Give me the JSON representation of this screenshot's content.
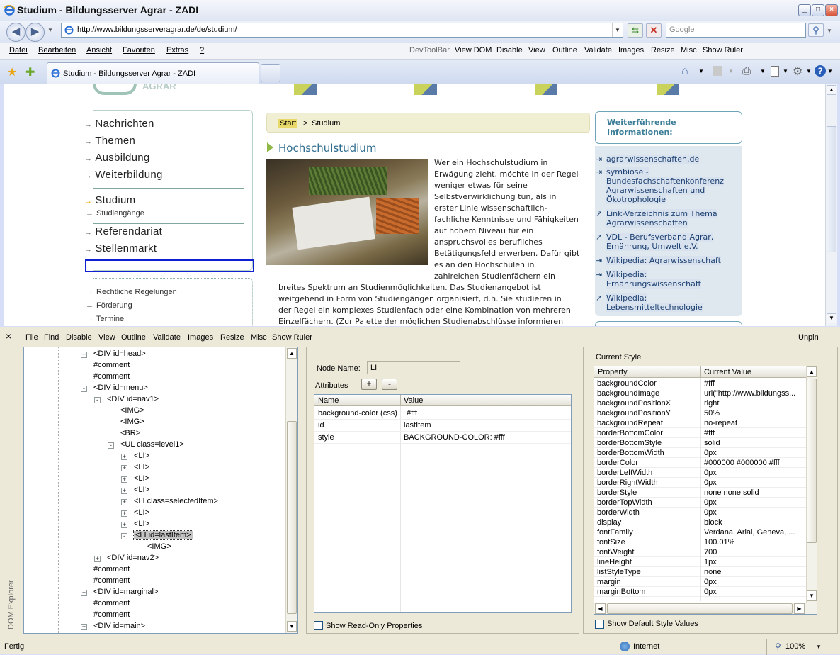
{
  "window": {
    "title": "Studium - Bildungsserver Agrar - ZADI"
  },
  "address": {
    "url": "http://www.bildungsserveragrar.de/de/studium/",
    "search_placeholder": "Google"
  },
  "menu": {
    "items": [
      "Datei",
      "Bearbeiten",
      "Ansicht",
      "Favoriten",
      "Extras",
      "?"
    ]
  },
  "devtoolbar": {
    "items": [
      "DevToolBar",
      "View DOM",
      "Disable",
      "View",
      "Outline",
      "Validate",
      "Images",
      "Resize",
      "Misc",
      "Show Ruler"
    ]
  },
  "tab": {
    "label": "Studium - Bildungsserver Agrar - ZADI"
  },
  "page": {
    "logo_text": "AGRAR",
    "nav1": [
      "Nachrichten",
      "Themen",
      "Ausbildung",
      "Weiterbildung"
    ],
    "selected": "Studium",
    "sub": "Studiengänge",
    "nav1b": [
      "Referendariat",
      "Stellenmarkt"
    ],
    "marginal": [
      "Rechtliche Regelungen",
      "Förderung",
      "Termine"
    ],
    "breadcrumb_start": "Start",
    "breadcrumb_sep": ">",
    "breadcrumb_current": "Studium",
    "heading": "Hochschulstudium",
    "para_lines_right": [
      "Wer ein Hochschulstudium in",
      "Erwägung zieht, möchte in der Regel",
      "weniger etwas für seine",
      "Selbstverwirklichung tun, als in",
      "erster Linie wissenschaftlich-",
      "fachliche Kenntnisse und Fähigkeiten",
      "auf hohem Niveau für ein",
      "anspruchsvolles berufliches",
      "Betätigungsfeld erwerben. Dafür gibt",
      "es an den Hochschulen in",
      "zahlreichen Studienfächern ein"
    ],
    "para_lines_full": [
      "breites Spektrum an Studienmöglichkeiten. Das Studienangebot ist",
      "weitgehend in Form von Studiengängen organisiert, d.h. Sie studieren in",
      "der Regel ein komplexes Studienfach oder eine Kombination von mehreren",
      "Einzelfächern. (Zur Palette der möglichen Studienabschlüsse informieren"
    ],
    "side_title_1": "Weiterführende",
    "side_title_2": "Informationen:",
    "links": [
      [
        "agrarwissenschaften.de"
      ],
      [
        "symbiose -",
        "Bundesfachschaftenkonferenz",
        "Agrarwissenschaften und",
        "Ökotrophologie"
      ],
      [
        "Link-Verzeichnis zum Thema",
        "Agrarwissenschaften"
      ],
      [
        "VDL - Berufsverband Agrar,",
        "Ernährung, Umwelt e.V."
      ],
      [
        "Wikipedia: Agrarwissenschaft"
      ],
      [
        "Wikipedia:",
        "Ernährungswissenschaft"
      ],
      [
        "Wikipedia:",
        "Lebensmitteltechnologie"
      ]
    ]
  },
  "dom": {
    "close": "×",
    "menu": [
      "File",
      "Find",
      "Disable",
      "View",
      "Outline",
      "Validate",
      "Images",
      "Resize",
      "Misc",
      "Show Ruler"
    ],
    "unpin": "Unpin",
    "sidebar_label": "DOM Explorer",
    "tree": [
      {
        "t": "<DIV id=head>",
        "x": 0,
        "e": "+"
      },
      {
        "t": "#comment",
        "x": 0,
        "e": ""
      },
      {
        "t": "#comment",
        "x": 0,
        "e": ""
      },
      {
        "t": "<DIV id=menu>",
        "x": 0,
        "e": "-"
      },
      {
        "t": "<DIV id=nav1>",
        "x": 1,
        "e": "-"
      },
      {
        "t": "<IMG>",
        "x": 2,
        "e": ""
      },
      {
        "t": "<IMG>",
        "x": 2,
        "e": ""
      },
      {
        "t": "<BR>",
        "x": 2,
        "e": ""
      },
      {
        "t": "<UL class=level1>",
        "x": 2,
        "e": "-"
      },
      {
        "t": "<LI>",
        "x": 3,
        "e": "+"
      },
      {
        "t": "<LI>",
        "x": 3,
        "e": "+"
      },
      {
        "t": "<LI>",
        "x": 3,
        "e": "+"
      },
      {
        "t": "<LI>",
        "x": 3,
        "e": "+"
      },
      {
        "t": "<LI class=selectedItem>",
        "x": 3,
        "e": "+"
      },
      {
        "t": "<LI>",
        "x": 3,
        "e": "+"
      },
      {
        "t": "<LI>",
        "x": 3,
        "e": "+"
      },
      {
        "t": "<LI id=lastItem>",
        "x": 3,
        "e": "-",
        "sel": true
      },
      {
        "t": "<IMG>",
        "x": 4,
        "e": ""
      },
      {
        "t": "<DIV id=nav2>",
        "x": 1,
        "e": "+"
      },
      {
        "t": "#comment",
        "x": 0,
        "e": ""
      },
      {
        "t": "#comment",
        "x": 0,
        "e": ""
      },
      {
        "t": "<DIV id=marginal>",
        "x": 0,
        "e": "+"
      },
      {
        "t": "#comment",
        "x": 0,
        "e": ""
      },
      {
        "t": "#comment",
        "x": 0,
        "e": ""
      },
      {
        "t": "<DIV id=main>",
        "x": 0,
        "e": "+"
      }
    ],
    "node_name_label": "Node Name:",
    "node_name": "LI",
    "attributes_label": "Attributes",
    "add": "+",
    "remove": "-",
    "attr_cols": [
      "Name",
      "Value"
    ],
    "attrs": [
      [
        "background-color (css)",
        "#fff"
      ],
      [
        "id",
        "lastItem"
      ],
      [
        "style",
        "BACKGROUND-COLOR: #fff"
      ]
    ],
    "show_readonly": "Show Read-Only Properties",
    "current_style": "Current Style",
    "style_cols": [
      "Property",
      "Current Value"
    ],
    "styles": [
      [
        "backgroundColor",
        "#fff"
      ],
      [
        "backgroundImage",
        "url(\"http://www.bildungss..."
      ],
      [
        "backgroundPositionX",
        "right"
      ],
      [
        "backgroundPositionY",
        "50%"
      ],
      [
        "backgroundRepeat",
        "no-repeat"
      ],
      [
        "borderBottomColor",
        "#fff"
      ],
      [
        "borderBottomStyle",
        "solid"
      ],
      [
        "borderBottomWidth",
        "0px"
      ],
      [
        "borderColor",
        "#000000 #000000 #fff"
      ],
      [
        "borderLeftWidth",
        "0px"
      ],
      [
        "borderRightWidth",
        "0px"
      ],
      [
        "borderStyle",
        "none none solid"
      ],
      [
        "borderTopWidth",
        "0px"
      ],
      [
        "borderWidth",
        "0px"
      ],
      [
        "display",
        "block"
      ],
      [
        "fontFamily",
        "Verdana, Arial, Geneva, ..."
      ],
      [
        "fontSize",
        "100.01%"
      ],
      [
        "fontWeight",
        "700"
      ],
      [
        "lineHeight",
        "1px"
      ],
      [
        "listStyleType",
        "none"
      ],
      [
        "margin",
        "0px"
      ],
      [
        "marginBottom",
        "0px"
      ]
    ],
    "show_default": "Show Default Style Values"
  },
  "status": {
    "left": "Fertig",
    "zone": "Internet",
    "zoom": "100%"
  }
}
